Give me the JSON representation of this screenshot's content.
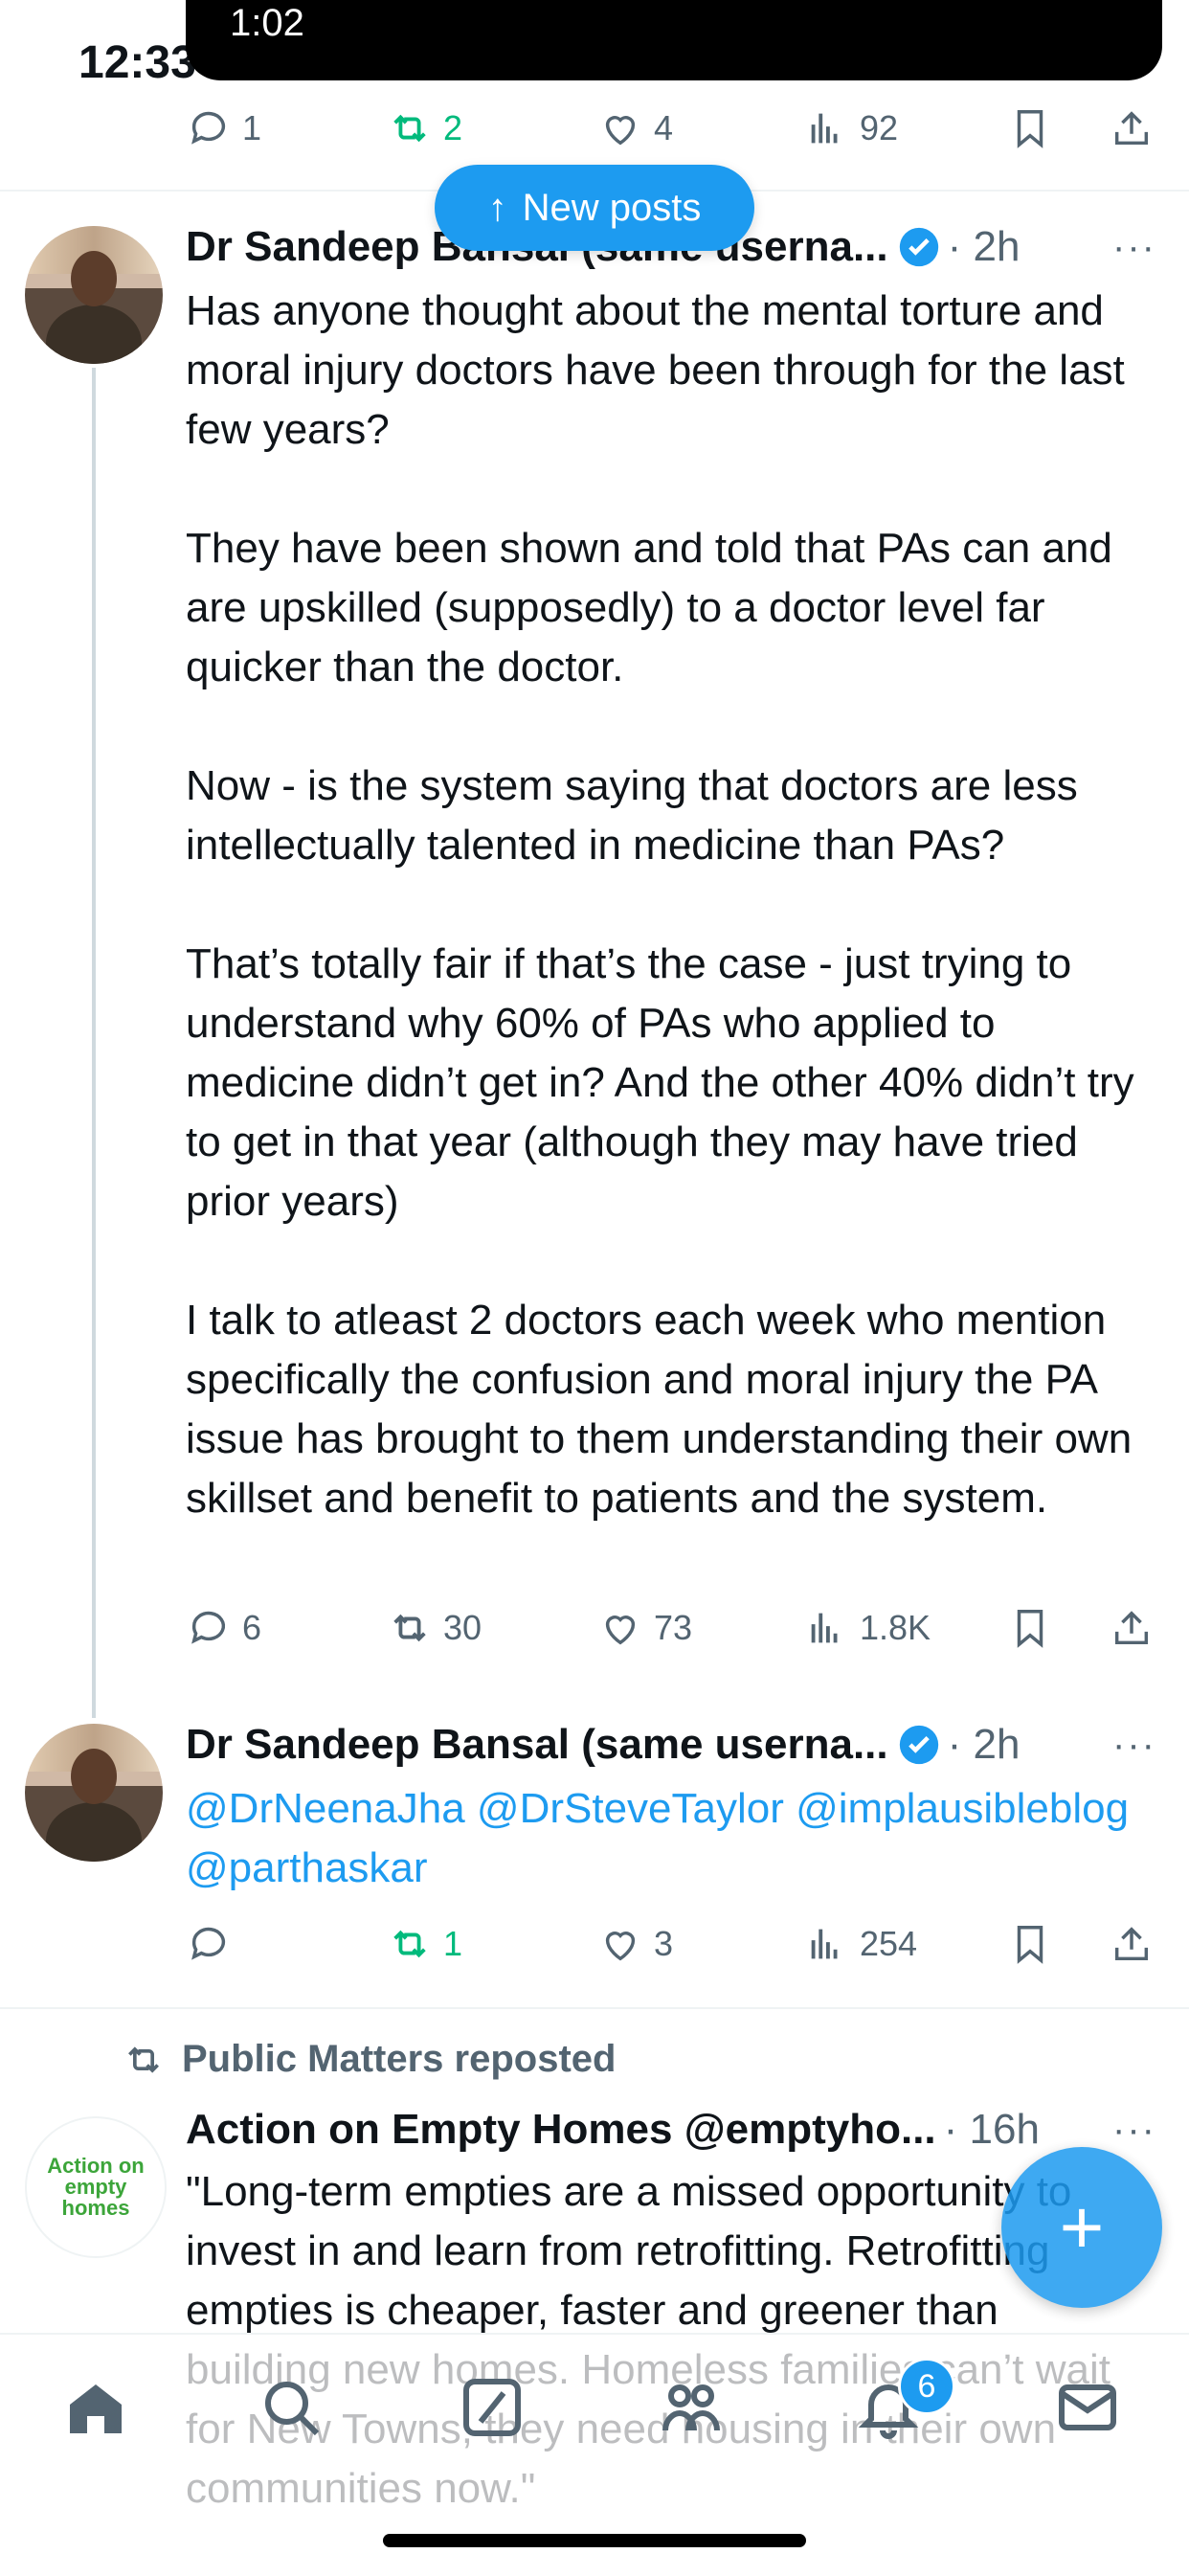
{
  "status_bar": {
    "time": "12:33",
    "island_time": "1:02"
  },
  "new_posts_label": "New posts",
  "top_actions": {
    "replies": "1",
    "reposts": "2",
    "likes": "4",
    "views": "92"
  },
  "tweet1": {
    "name": "Dr Sandeep Bansal (same userna...",
    "time": "· 2h",
    "body": "Has anyone thought about the mental torture and moral injury doctors have been through for the last few years?\n\nThey have been shown and told that PAs can and are upskilled (supposedly) to a doctor level far quicker than the doctor.\n\nNow - is the system saying that doctors are less intellectually talented in medicine than PAs?\n\nThat’s totally fair if that’s the case - just trying to understand why 60% of PAs who applied to medicine didn’t get in? And the other 40% didn’t try to get in that year (although they may have tried prior years)\n\nI talk to atleast 2 doctors each week who mention specifically the confusion and moral injury the PA issue has brought to them understanding their own skillset and benefit to patients and the system.",
    "actions": {
      "replies": "6",
      "reposts": "30",
      "likes": "73",
      "views": "1.8K"
    }
  },
  "tweet2": {
    "name": "Dr Sandeep Bansal (same userna...",
    "time": "· 2h",
    "mentions": "@DrNeenaJha @DrSteveTaylor @implausibleblog @parthaskar",
    "actions": {
      "replies": "",
      "reposts": "1",
      "likes": "3",
      "views": "254"
    }
  },
  "tweet3": {
    "repost_label": "Public Matters reposted",
    "name": "Action on Empty Homes @emptyho...",
    "time": "· 16h",
    "logo_text": [
      "Action on",
      "empty",
      "homes"
    ],
    "body": "\"Long-term empties are a missed opportunity to invest in and learn from retrofitting. Retrofitting empties is cheaper, faster and greener than building new homes. Homeless families can’t wait for New Towns, they need housing in their own communities now.\""
  },
  "tabbar": {
    "notification_count": "6"
  },
  "colors": {
    "accent": "#1d9bf0",
    "repost_green": "#00ba7c",
    "muted": "#536471"
  }
}
